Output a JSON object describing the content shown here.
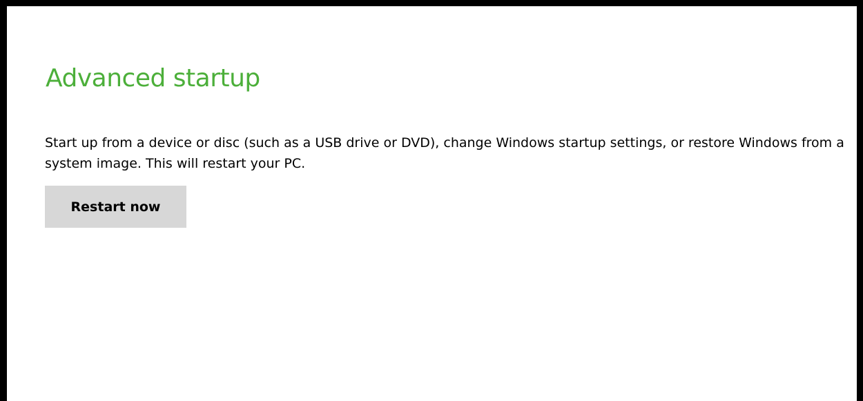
{
  "advanced_startup": {
    "title": "Advanced startup",
    "description": "Start up from a device or disc (such as a USB drive or DVD), change Windows startup settings, or restore Windows from a system image. This will restart your PC.",
    "restart_button_label": "Restart now"
  },
  "colors": {
    "accent": "#4caf3a",
    "button_background": "#d7d7d7",
    "text": "#000000",
    "frame": "#000000",
    "panel_background": "#ffffff"
  }
}
